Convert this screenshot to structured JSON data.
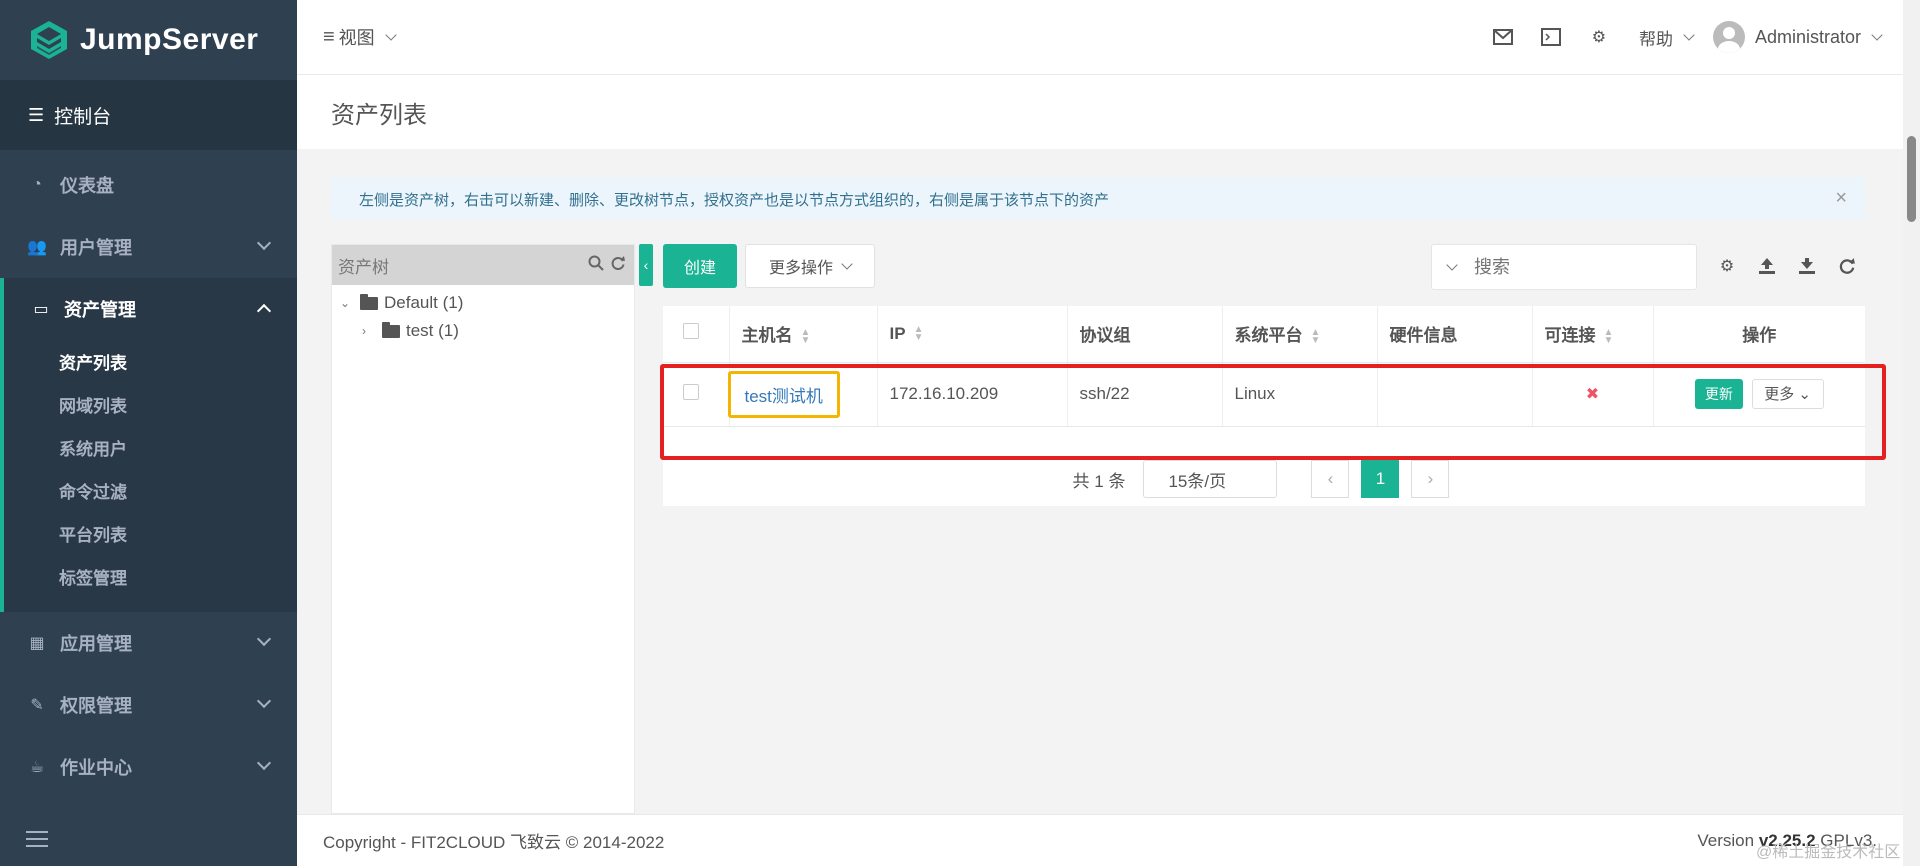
{
  "brand": {
    "name": "JumpServer"
  },
  "sidebar": {
    "console_label": "控制台",
    "items": [
      {
        "label": "仪表盘",
        "icon": "dashboard-icon"
      },
      {
        "label": "用户管理",
        "icon": "users-icon"
      },
      {
        "label": "资产管理",
        "icon": "inbox-icon",
        "expanded": true,
        "sub_items": [
          "资产列表",
          "网域列表",
          "系统用户",
          "命令过滤",
          "平台列表",
          "标签管理"
        ],
        "active_sub": "资产列表"
      },
      {
        "label": "应用管理",
        "icon": "grid-icon"
      },
      {
        "label": "权限管理",
        "icon": "edit-icon"
      },
      {
        "label": "作业中心",
        "icon": "coffee-icon"
      }
    ]
  },
  "header": {
    "view_label": "视图",
    "help_label": "帮助",
    "username": "Administrator"
  },
  "page": {
    "title": "资产列表",
    "alert": "左侧是资产树，右击可以新建、删除、更改树节点，授权资产也是以节点方式组织的，右侧是属于该节点下的资产"
  },
  "tree": {
    "search_placeholder": "资产树",
    "nodes": [
      {
        "label": "Default (1)",
        "level": 0,
        "expanded": true
      },
      {
        "label": "test (1)",
        "level": 1,
        "expanded": false
      }
    ]
  },
  "toolbar": {
    "create_label": "创建",
    "more_actions_label": "更多操作",
    "search_placeholder": "搜索"
  },
  "table": {
    "columns": [
      "主机名",
      "IP",
      "协议组",
      "系统平台",
      "硬件信息",
      "可连接",
      "操作"
    ],
    "rows": [
      {
        "hostname": "test测试机",
        "ip": "172.16.10.209",
        "protocols": "ssh/22",
        "platform": "Linux",
        "hardware": "",
        "connectable": "✖",
        "update_label": "更新",
        "more_label": "更多"
      }
    ]
  },
  "pagination": {
    "total_label": "共 1 条",
    "page_size": "15条/页",
    "current_page": "1"
  },
  "footer": {
    "copyright": "Copyright - FIT2CLOUD 飞致云 © 2014-2022",
    "version_prefix": "Version",
    "version": "v2.25.2",
    "license": "GPLv3."
  },
  "watermark": "@稀土掘金技术社区",
  "colors": {
    "accent": "#1ab394",
    "sidebar": "#2f4050",
    "highlight_red": "#e52020",
    "highlight_yellow": "#f5b400"
  }
}
